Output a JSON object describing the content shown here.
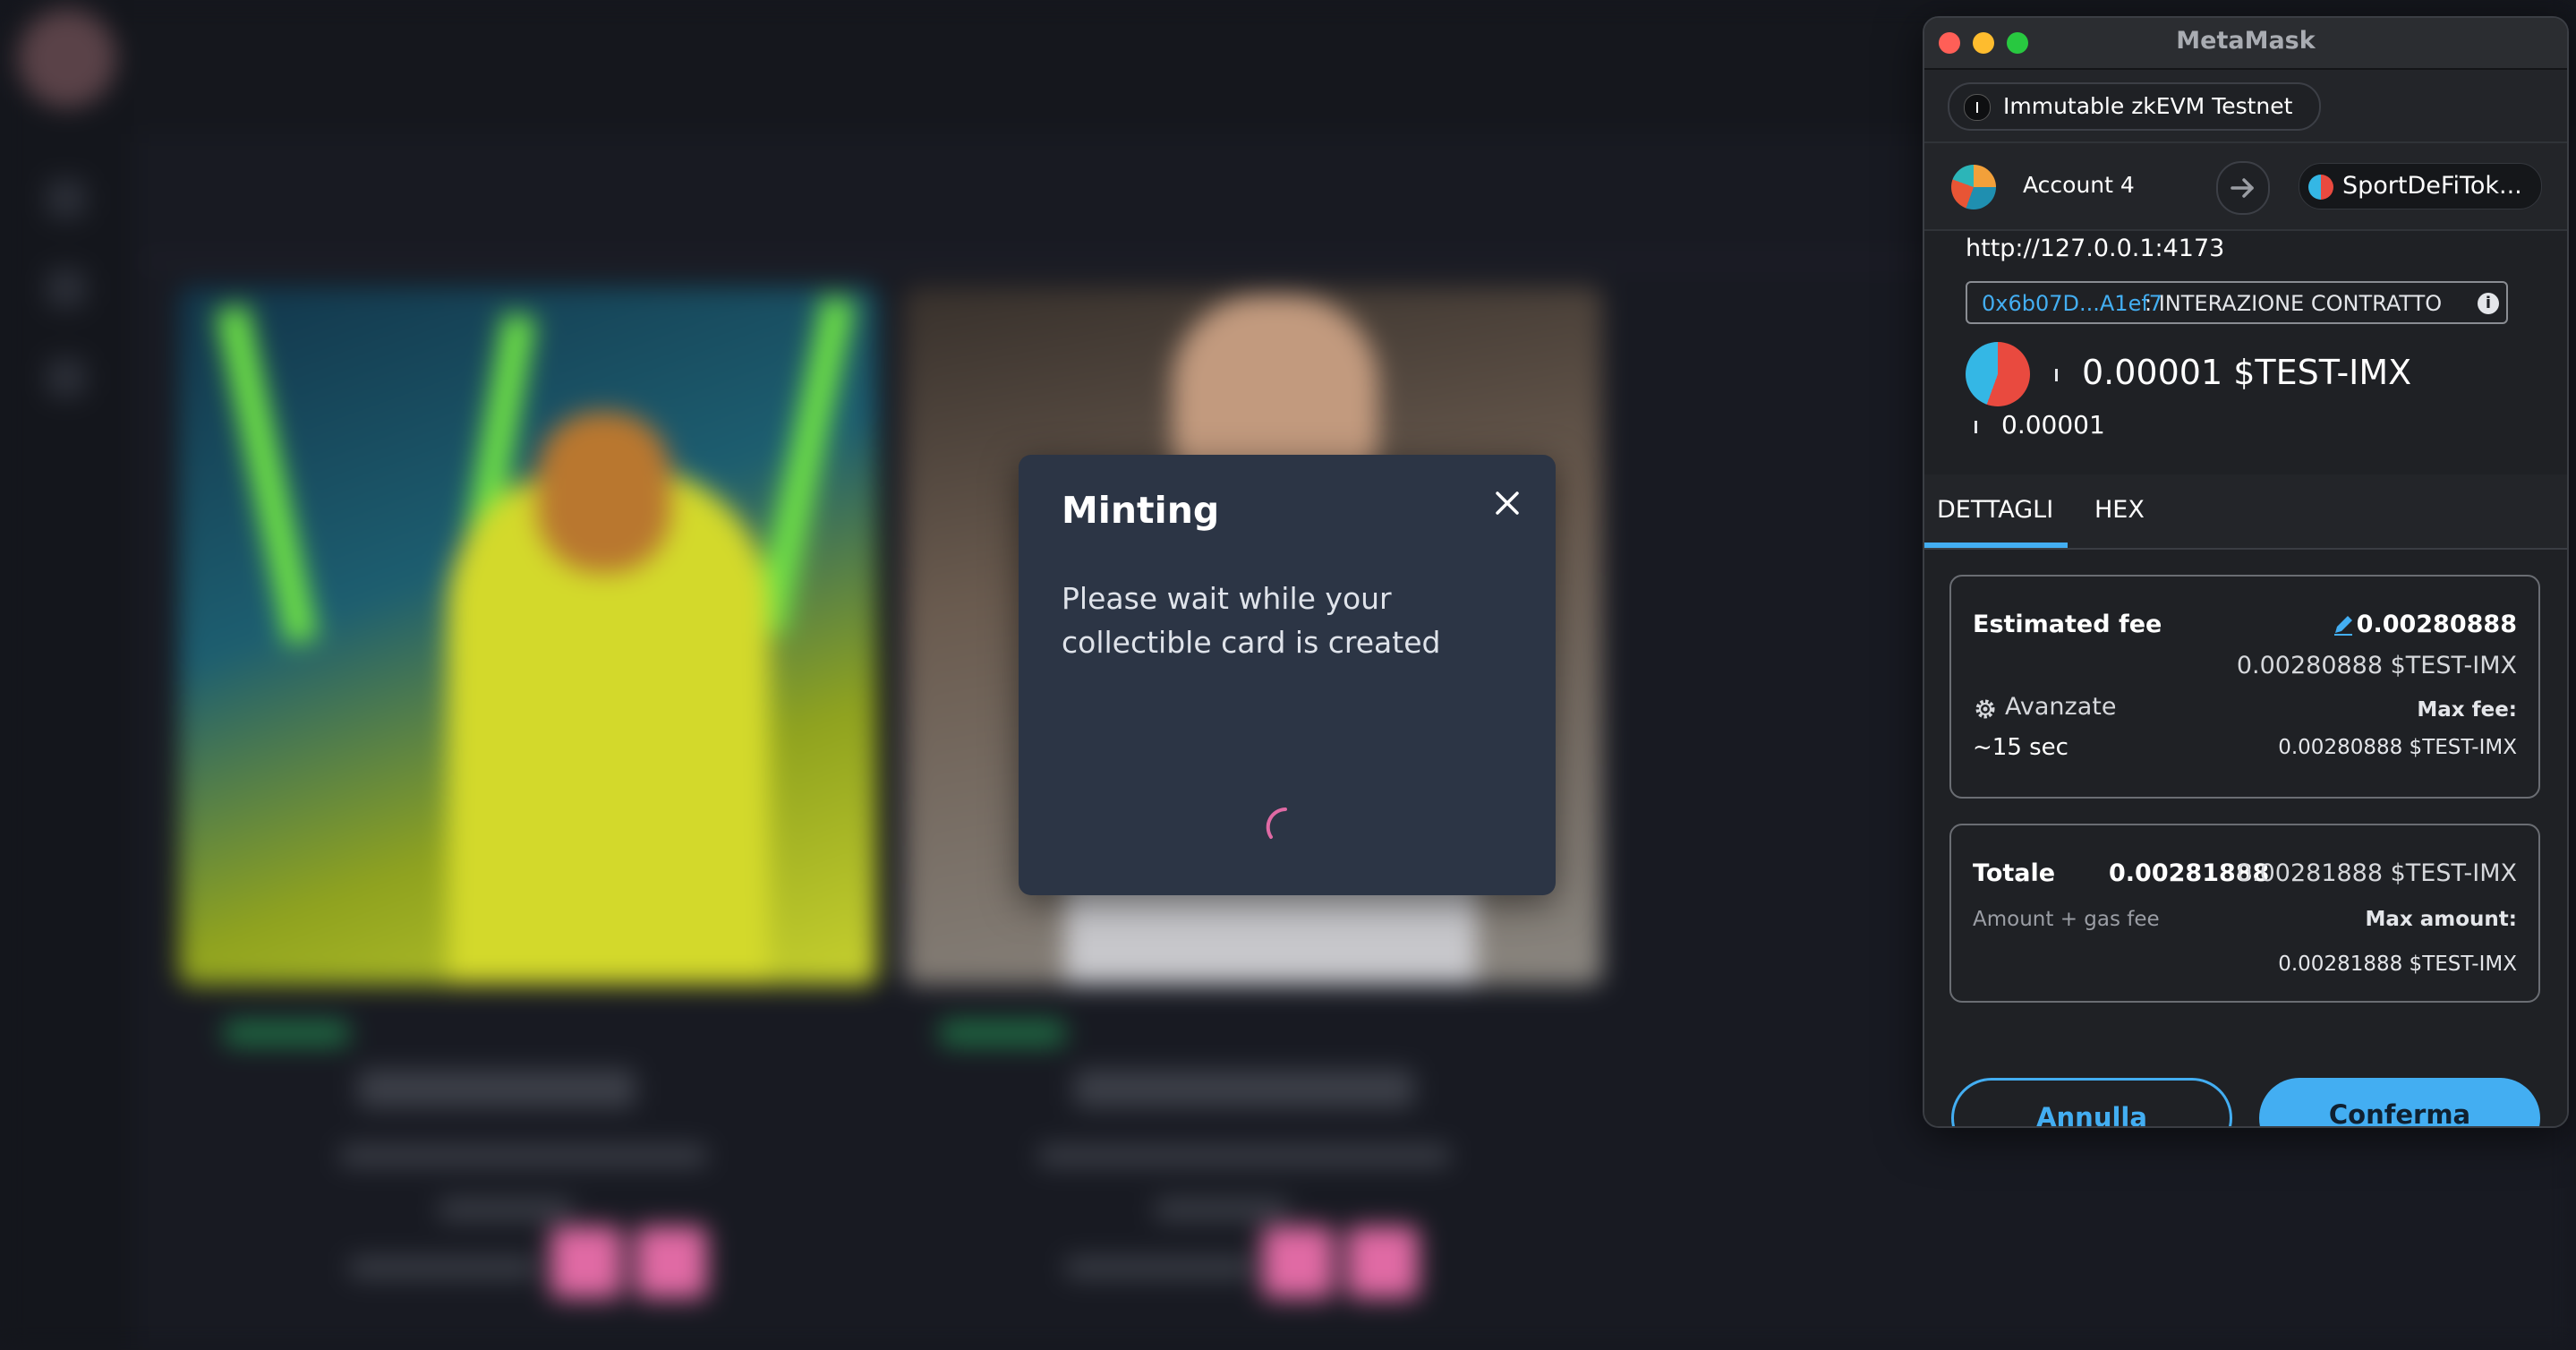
{
  "mint_modal": {
    "title": "Minting",
    "message": "Please wait while your collectible card is created"
  },
  "metamask": {
    "window_title": "MetaMask",
    "network": "Immutable zkEVM Testnet",
    "account_name": "Account 4",
    "token_name": "SportDeFiTok...",
    "origin": "http://127.0.0.1:4173",
    "contract_address": "0x6b07D...A1ef7",
    "contract_type": ": INTERAZIONE CONTRATTO",
    "value_primary": "0.00001 $TEST-IMX",
    "value_secondary": "0.00001",
    "tabs": [
      "DETTAGLI",
      "HEX"
    ],
    "fee": {
      "label": "Estimated fee",
      "amount": "0.00280888",
      "amount_full": "0.00280888 $TEST-IMX",
      "advanced_label": "Avanzate",
      "time": "~15 sec",
      "max_fee_label": "Max fee:",
      "max_fee_value": "0.00280888 $TEST-IMX"
    },
    "total": {
      "label": "Totale",
      "amount": "0.00281888",
      "amount_full": "0.00281888 $TEST-IMX",
      "sub_label": "Amount + gas fee",
      "max_amount_label": "Max amount:",
      "max_amount_value": "0.00281888 $TEST-IMX"
    },
    "buttons": {
      "cancel": "Annulla",
      "confirm": "Conferma"
    },
    "accent_color": "#43aef2"
  },
  "icons": [
    "close-icon",
    "spinner-icon",
    "arrow-right-icon",
    "edit-icon",
    "gear-icon",
    "info-icon"
  ]
}
